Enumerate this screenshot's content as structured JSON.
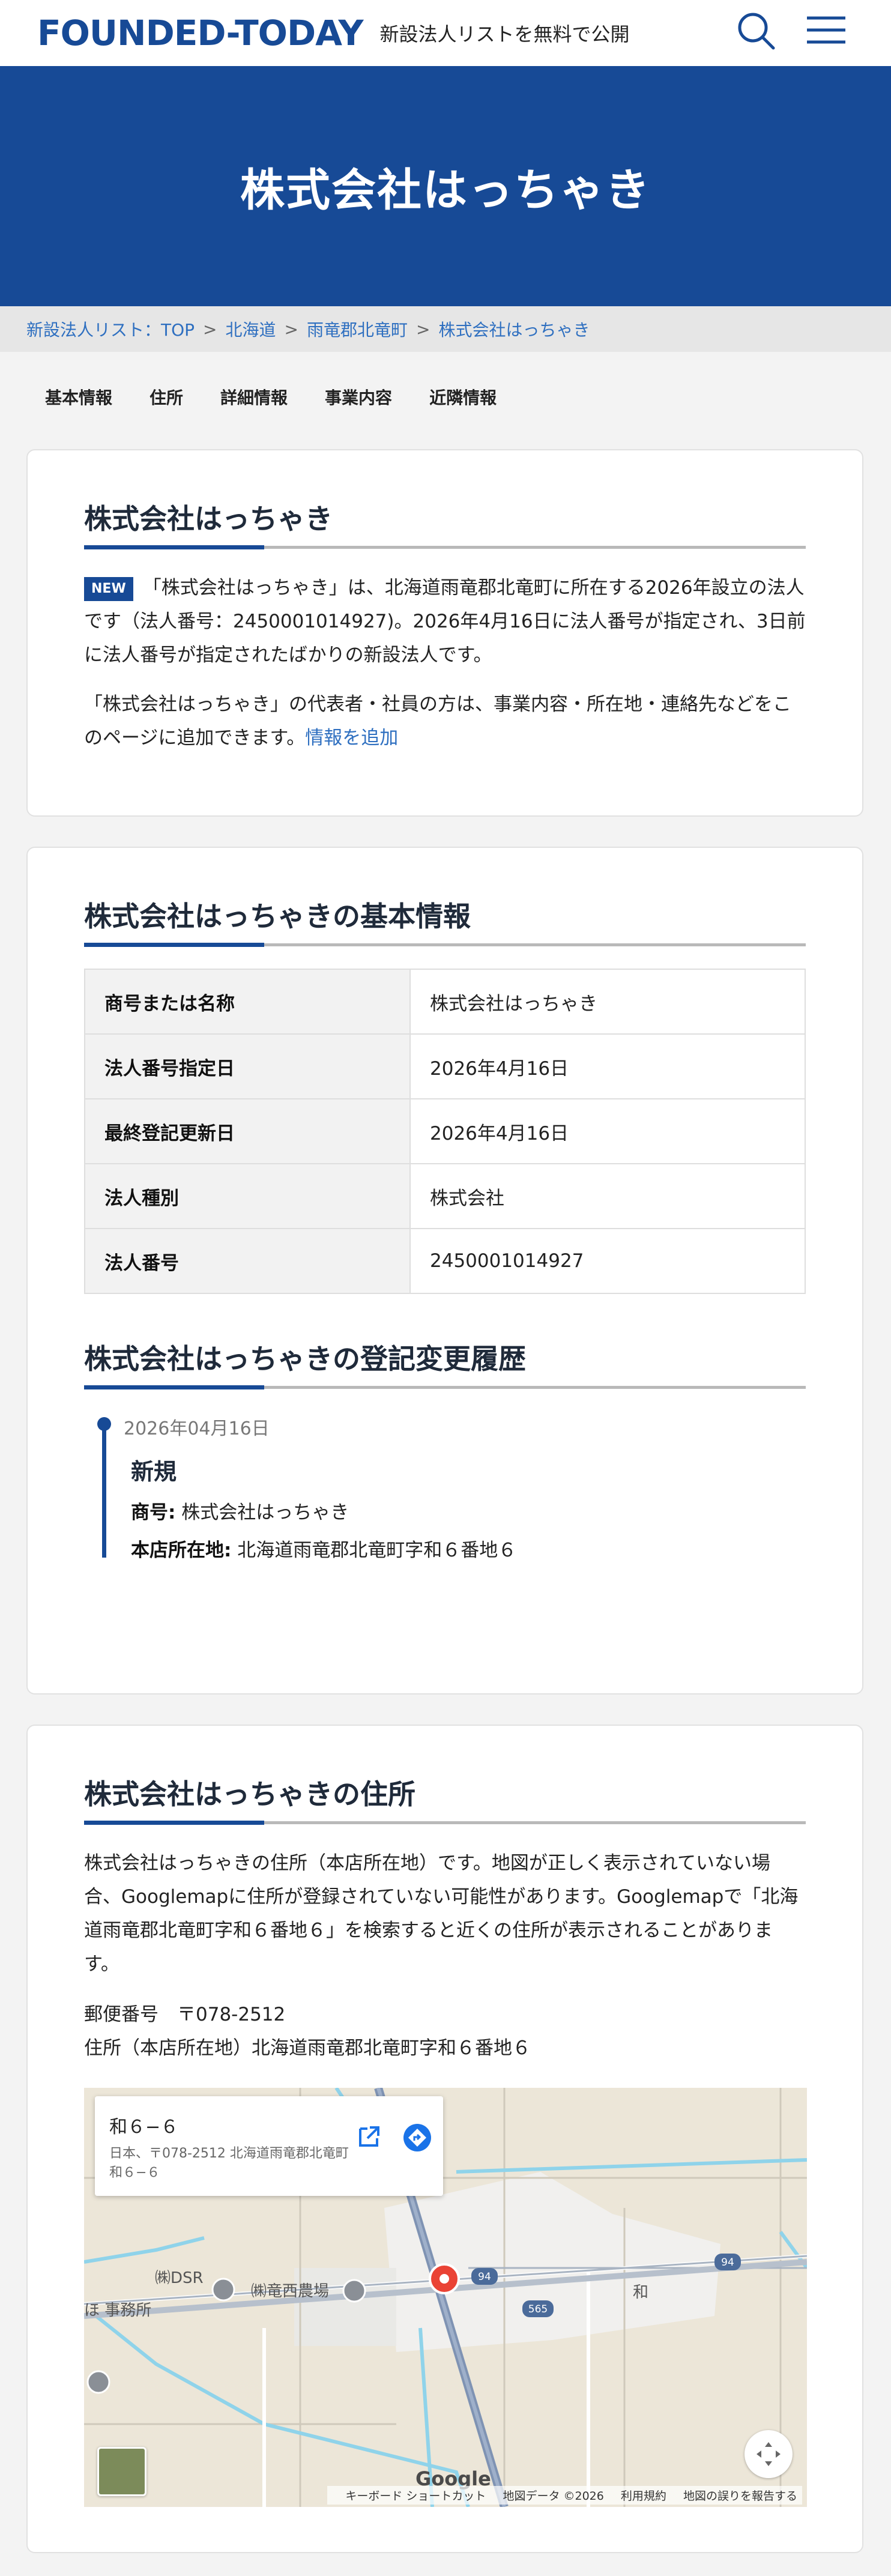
{
  "header": {
    "logo": "FOUNDED-TODAY",
    "tagline": "新設法人リストを無料で公開",
    "icons": [
      "search-icon",
      "menu-icon"
    ],
    "brand_color": "#174a96"
  },
  "hero": {
    "title": "株式会社はっちゃき"
  },
  "breadcrumb": {
    "items": [
      "新設法人リスト：TOP",
      "北海道",
      "雨竜郡北竜町",
      "株式会社はっちゃき"
    ],
    "separator": ">"
  },
  "tabs": [
    "基本情報",
    "住所",
    "詳細情報",
    "事業内容",
    "近隣情報"
  ],
  "intro": {
    "title": "株式会社はっちゃき",
    "badge": "NEW",
    "text": "「株式会社はっちゃき」は、北海道雨竜郡北竜町に所在する2026年設立の法人です（法人番号：2450001014927)。2026年4月16日に法人番号が指定され、3日前に法人番号が指定されたばかりの新設法人です。",
    "text2": "「株式会社はっちゃき」の代表者・社員の方は、事業内容・所在地・連絡先などをこのページに追加できます。",
    "link": "情報を追加"
  },
  "basic": {
    "title": "株式会社はっちゃきの基本情報",
    "rows": [
      {
        "label": "商号または名称",
        "value": "株式会社はっちゃき"
      },
      {
        "label": "法人番号指定日",
        "value": "2026年4月16日"
      },
      {
        "label": "最終登記更新日",
        "value": "2026年4月16日"
      },
      {
        "label": "法人種別",
        "value": "株式会社"
      },
      {
        "label": "法人番号",
        "value": "2450001014927"
      }
    ]
  },
  "history": {
    "title": "株式会社はっちゃきの登記変更履歴",
    "date": "2026年04月16日",
    "event": "新規",
    "name_label": "商号:",
    "name_value": "株式会社はっちゃき",
    "addr_label": "本店所在地:",
    "addr_value": "北海道雨竜郡北竜町字和６番地６"
  },
  "address": {
    "title": "株式会社はっちゃきの住所",
    "text": "株式会社はっちゃきの住所（本店所在地）です。地図が正しく表示されていない場合、Googlemapに住所が登録されていない可能性があります。Googlemapで「北海道雨竜郡北竜町字和６番地６」を検索すると近くの住所が表示されることがあります。",
    "postal": "郵便番号　〒078-2512",
    "address": "住所（本店所在地）北海道雨竜郡北竜町字和６番地６"
  },
  "map": {
    "card_title": "和６−６",
    "card_address": "日本、〒078-2512 北海道雨竜郡北竜町和６−６",
    "labels": {
      "dsr": "㈱DSR",
      "farm": "㈱竜西農場",
      "office": "ほ 事務所",
      "wa": "和",
      "r94a": "94",
      "r94b": "94",
      "r565": "565"
    },
    "google": "Google",
    "footer": [
      "キーボード ショートカット",
      "地図データ ©2026",
      "利用規約",
      "地図の誤りを報告する"
    ],
    "icons": [
      "open-in-new-icon",
      "directions-icon",
      "location-pin-icon",
      "fullscreen-icon",
      "layers-icon"
    ]
  }
}
